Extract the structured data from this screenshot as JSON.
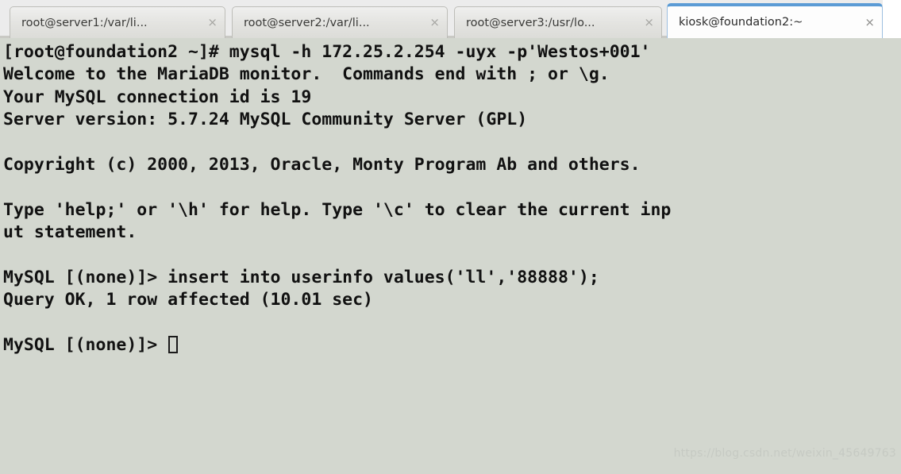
{
  "window": {
    "type": "terminal-emulator",
    "background_color": "#d3d7cf",
    "tabbar_color": "#ececec",
    "active_tab_accent": "#5b9bd5",
    "text_color": "#111111"
  },
  "tabs": [
    {
      "label": "root@server1:/var/li...",
      "close_glyph": "×",
      "active": false
    },
    {
      "label": "root@server2:/var/li...",
      "close_glyph": "×",
      "active": false
    },
    {
      "label": "root@server3:/usr/lo...",
      "close_glyph": "×",
      "active": false
    },
    {
      "label": "kiosk@foundation2:~",
      "close_glyph": "×",
      "active": true
    }
  ],
  "terminal": {
    "lines": [
      "[root@foundation2 ~]# mysql -h 172.25.2.254 -uyx -p'Westos+001'",
      "Welcome to the MariaDB monitor.  Commands end with ; or \\g.",
      "Your MySQL connection id is 19",
      "Server version: 5.7.24 MySQL Community Server (GPL)",
      "",
      "Copyright (c) 2000, 2013, Oracle, Monty Program Ab and others.",
      "",
      "Type 'help;' or '\\h' for help. Type '\\c' to clear the current inp",
      "ut statement.",
      "",
      "MySQL [(none)]> insert into userinfo values('ll','88888');",
      "Query OK, 1 row affected (10.01 sec)",
      ""
    ],
    "prompt": "MySQL [(none)]> ",
    "cursor": {
      "style": "hollow-block",
      "visible": true
    }
  },
  "watermark": {
    "text": "https://blog.csdn.net/weixin_45649763"
  }
}
